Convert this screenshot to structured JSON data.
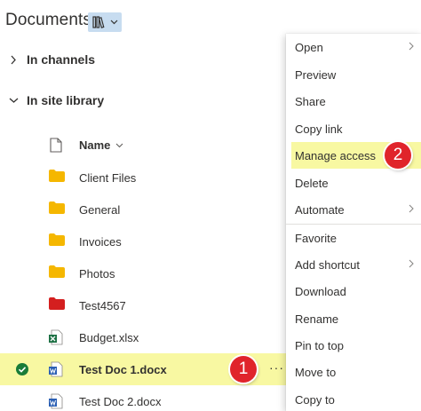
{
  "header": {
    "title": "Documents"
  },
  "tree": {
    "channels_label": "In channels",
    "site_library_label": "In site library"
  },
  "columns": {
    "name_label": "Name"
  },
  "rows": [
    {
      "name": "Client Files",
      "type": "folder"
    },
    {
      "name": "General",
      "type": "folder"
    },
    {
      "name": "Invoices",
      "type": "folder"
    },
    {
      "name": "Photos",
      "type": "folder"
    },
    {
      "name": "Test4567",
      "type": "folder-red"
    },
    {
      "name": "Budget.xlsx",
      "type": "excel"
    },
    {
      "name": "Test Doc 1.docx",
      "type": "word",
      "selected": true
    },
    {
      "name": "Test Doc 2.docx",
      "type": "word"
    }
  ],
  "more_actions_label": "···",
  "badges": {
    "step1": "1",
    "step2": "2"
  },
  "context_menu": {
    "items": [
      {
        "label": "Open",
        "submenu": true
      },
      {
        "label": "Preview"
      },
      {
        "label": "Share"
      },
      {
        "label": "Copy link"
      },
      {
        "label": "Manage access",
        "highlighted": true
      },
      {
        "label": "Delete"
      },
      {
        "label": "Automate",
        "submenu": true
      },
      {
        "label": "Favorite"
      },
      {
        "label": "Add shortcut",
        "submenu": true
      },
      {
        "label": "Download"
      },
      {
        "label": "Rename"
      },
      {
        "label": "Pin to top"
      },
      {
        "label": "Move to"
      },
      {
        "label": "Copy to"
      }
    ]
  },
  "colors": {
    "highlight": "#f8f8a2",
    "folder": "#f5b700",
    "folder_red": "#d41f1f",
    "excel": "#1d7044",
    "word": "#2b5fb4",
    "badge": "#e0242b",
    "check": "#197c38"
  }
}
